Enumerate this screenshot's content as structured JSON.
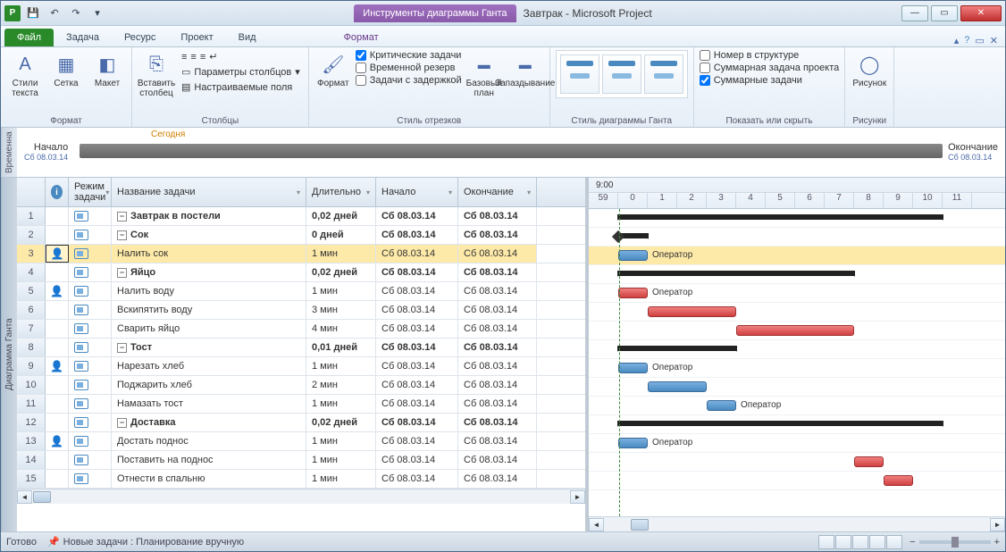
{
  "app": {
    "contextual_tab": "Инструменты диаграммы Ганта",
    "doc_title": "Завтрак  -  Microsoft Project"
  },
  "qat": {
    "app_letter": "P"
  },
  "tabs": {
    "file": "Файл",
    "items": [
      "Задача",
      "Ресурс",
      "Проект",
      "Вид"
    ],
    "context": "Формат"
  },
  "ribbon": {
    "format_group": {
      "label": "Формат",
      "text_styles": "Стили текста",
      "grid": "Сетка",
      "layout": "Макет"
    },
    "columns_group": {
      "label": "Столбцы",
      "insert": "Вставить столбец",
      "col_params": "Параметры столбцов",
      "custom_fields": "Настраиваемые поля"
    },
    "bar_styles_group": {
      "label": "Стиль отрезков",
      "format": "Формат",
      "critical": "Критические задачи",
      "slack": "Временной резерв",
      "late": "Задачи с задержкой",
      "baseline": "Базовый план",
      "slippage": "Запаздывание"
    },
    "gantt_style_group": {
      "label": "Стиль диаграммы Ганта"
    },
    "show_hide_group": {
      "label": "Показать или скрыть",
      "outline_num": "Номер в структуре",
      "project_summary": "Суммарная задача проекта",
      "summary_tasks": "Суммарные задачи"
    },
    "drawings_group": {
      "label": "Рисунки",
      "drawing": "Рисунок"
    }
  },
  "timeline": {
    "tab": "Временна",
    "today": "Сегодня",
    "start": "Начало",
    "finish": "Окончание",
    "start_date": "Сб 08.03.14",
    "finish_date": "Сб 08.03.14"
  },
  "gantt_tab": "Диаграмма Ганта",
  "columns": {
    "info": "i",
    "mode": "Режим задачи",
    "name": "Название задачи",
    "duration": "Длительно",
    "start": "Начало",
    "finish": "Окончание"
  },
  "rows": [
    {
      "n": 1,
      "lvl": 0,
      "sum": true,
      "name": "Завтрак в постели",
      "dur": "0,02 дней",
      "start": "Сб 08.03.14",
      "end": "Сб 08.03.14"
    },
    {
      "n": 2,
      "lvl": 1,
      "sum": true,
      "name": "Сок",
      "dur": "0 дней",
      "start": "Сб 08.03.14",
      "end": "Сб 08.03.14"
    },
    {
      "n": 3,
      "lvl": 2,
      "name": "Налить сок",
      "dur": "1 мин",
      "start": "Сб 08.03.14",
      "end": "Сб 08.03.14",
      "res": true,
      "sel": true
    },
    {
      "n": 4,
      "lvl": 1,
      "sum": true,
      "name": "Яйцо",
      "dur": "0,02 дней",
      "start": "Сб 08.03.14",
      "end": "Сб 08.03.14"
    },
    {
      "n": 5,
      "lvl": 2,
      "name": "Налить воду",
      "dur": "1 мин",
      "start": "Сб 08.03.14",
      "end": "Сб 08.03.14",
      "res": true
    },
    {
      "n": 6,
      "lvl": 2,
      "name": "Вскипятить воду",
      "dur": "3 мин",
      "start": "Сб 08.03.14",
      "end": "Сб 08.03.14"
    },
    {
      "n": 7,
      "lvl": 2,
      "name": "Сварить яйцо",
      "dur": "4 мин",
      "start": "Сб 08.03.14",
      "end": "Сб 08.03.14"
    },
    {
      "n": 8,
      "lvl": 1,
      "sum": true,
      "name": "Тост",
      "dur": "0,01 дней",
      "start": "Сб 08.03.14",
      "end": "Сб 08.03.14"
    },
    {
      "n": 9,
      "lvl": 2,
      "name": "Нарезать хлеб",
      "dur": "1 мин",
      "start": "Сб 08.03.14",
      "end": "Сб 08.03.14",
      "res": true
    },
    {
      "n": 10,
      "lvl": 2,
      "name": "Поджарить хлеб",
      "dur": "2 мин",
      "start": "Сб 08.03.14",
      "end": "Сб 08.03.14"
    },
    {
      "n": 11,
      "lvl": 2,
      "name": "Намазать тост",
      "dur": "1 мин",
      "start": "Сб 08.03.14",
      "end": "Сб 08.03.14"
    },
    {
      "n": 12,
      "lvl": 1,
      "sum": true,
      "name": "Доставка",
      "dur": "0,02 дней",
      "start": "Сб 08.03.14",
      "end": "Сб 08.03.14"
    },
    {
      "n": 13,
      "lvl": 2,
      "name": "Достать поднос",
      "dur": "1 мин",
      "start": "Сб 08.03.14",
      "end": "Сб 08.03.14",
      "res": true
    },
    {
      "n": 14,
      "lvl": 2,
      "name": "Поставить на поднос",
      "dur": "1 мин",
      "start": "Сб 08.03.14",
      "end": "Сб 08.03.14"
    },
    {
      "n": 15,
      "lvl": 2,
      "name": "Отнести в спальню",
      "dur": "1 мин",
      "start": "Сб 08.03.14",
      "end": "Сб 08.03.14"
    }
  ],
  "scale": {
    "top": "9:00",
    "ticks": [
      "59",
      "0",
      "1",
      "2",
      "3",
      "4",
      "5",
      "6",
      "7",
      "8",
      "9",
      "10",
      "11"
    ]
  },
  "bar_label": "Оператор",
  "chart_data": {
    "type": "gantt",
    "unit": "minutes",
    "time_origin": "9:00",
    "tasks": [
      {
        "id": 1,
        "name": "Завтрак в постели",
        "summary": true,
        "start": 0,
        "end": 11
      },
      {
        "id": 2,
        "name": "Сок",
        "summary": true,
        "start": 0,
        "end": 1,
        "milestone": true
      },
      {
        "id": 3,
        "name": "Налить сок",
        "start": 0,
        "end": 1,
        "critical": false,
        "resource": "Оператор"
      },
      {
        "id": 4,
        "name": "Яйцо",
        "summary": true,
        "start": 0,
        "end": 8
      },
      {
        "id": 5,
        "name": "Налить воду",
        "start": 0,
        "end": 1,
        "critical": true,
        "resource": "Оператор"
      },
      {
        "id": 6,
        "name": "Вскипятить воду",
        "start": 1,
        "end": 4,
        "critical": true
      },
      {
        "id": 7,
        "name": "Сварить яйцо",
        "start": 4,
        "end": 8,
        "critical": true
      },
      {
        "id": 8,
        "name": "Тост",
        "summary": true,
        "start": 0,
        "end": 4
      },
      {
        "id": 9,
        "name": "Нарезать хлеб",
        "start": 0,
        "end": 1,
        "critical": false,
        "resource": "Оператор"
      },
      {
        "id": 10,
        "name": "Поджарить хлеб",
        "start": 1,
        "end": 3,
        "critical": false
      },
      {
        "id": 11,
        "name": "Намазать тост",
        "start": 3,
        "end": 4,
        "critical": false,
        "resource": "Оператор"
      },
      {
        "id": 12,
        "name": "Доставка",
        "summary": true,
        "start": 0,
        "end": 11
      },
      {
        "id": 13,
        "name": "Достать поднос",
        "start": 0,
        "end": 1,
        "critical": false,
        "resource": "Оператор"
      },
      {
        "id": 14,
        "name": "Поставить на поднос",
        "start": 8,
        "end": 9,
        "critical": true
      },
      {
        "id": 15,
        "name": "Отнести в спальню",
        "start": 9,
        "end": 10,
        "critical": true
      }
    ]
  },
  "status": {
    "ready": "Готово",
    "new_tasks": "Новые задачи : Планирование вручную"
  }
}
